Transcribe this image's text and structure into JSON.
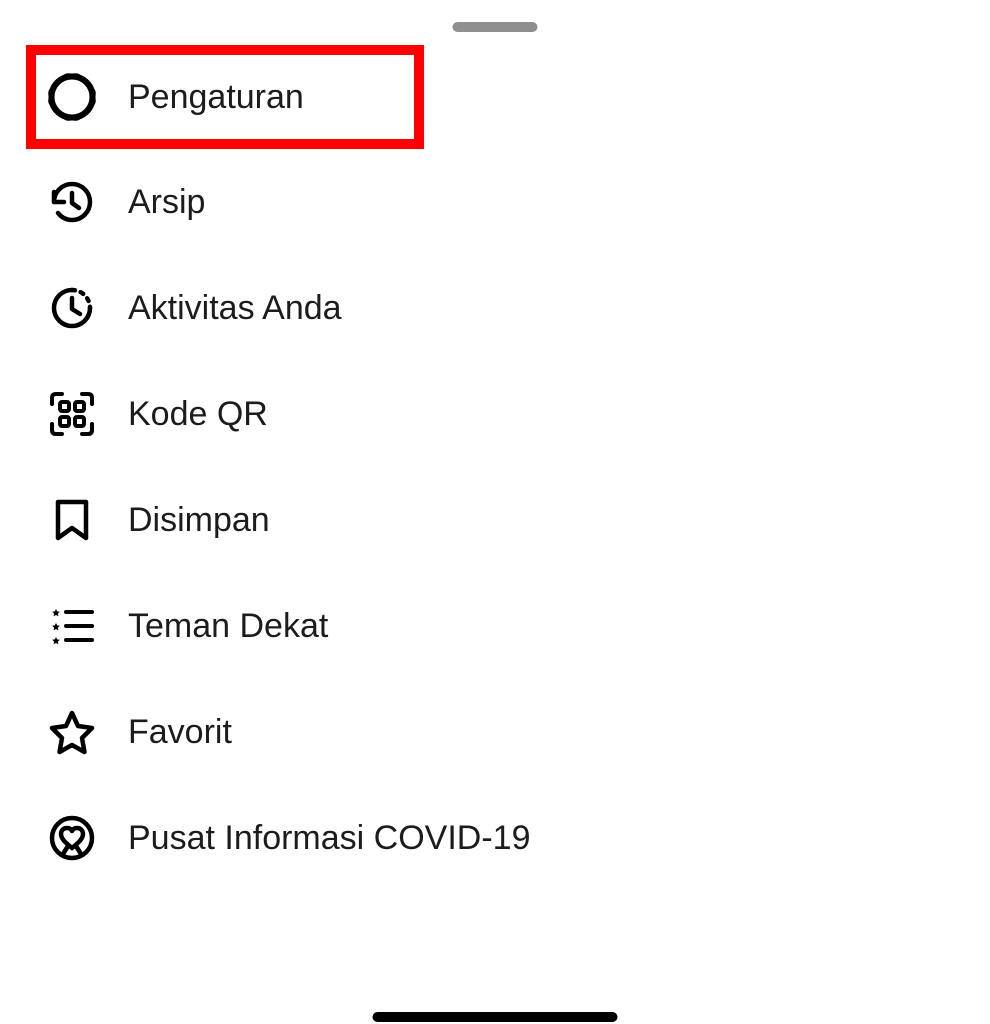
{
  "menu": {
    "items": [
      {
        "label": "Pengaturan",
        "icon": "gear-icon",
        "highlighted": true
      },
      {
        "label": "Arsip",
        "icon": "history-icon",
        "highlighted": false
      },
      {
        "label": "Aktivitas Anda",
        "icon": "activity-clock-icon",
        "highlighted": false
      },
      {
        "label": "Kode QR",
        "icon": "qr-code-icon",
        "highlighted": false
      },
      {
        "label": "Disimpan",
        "icon": "bookmark-icon",
        "highlighted": false
      },
      {
        "label": "Teman Dekat",
        "icon": "close-friends-icon",
        "highlighted": false
      },
      {
        "label": "Favorit",
        "icon": "star-icon",
        "highlighted": false
      },
      {
        "label": "Pusat Informasi COVID-19",
        "icon": "heart-ribbon-icon",
        "highlighted": false
      }
    ]
  }
}
